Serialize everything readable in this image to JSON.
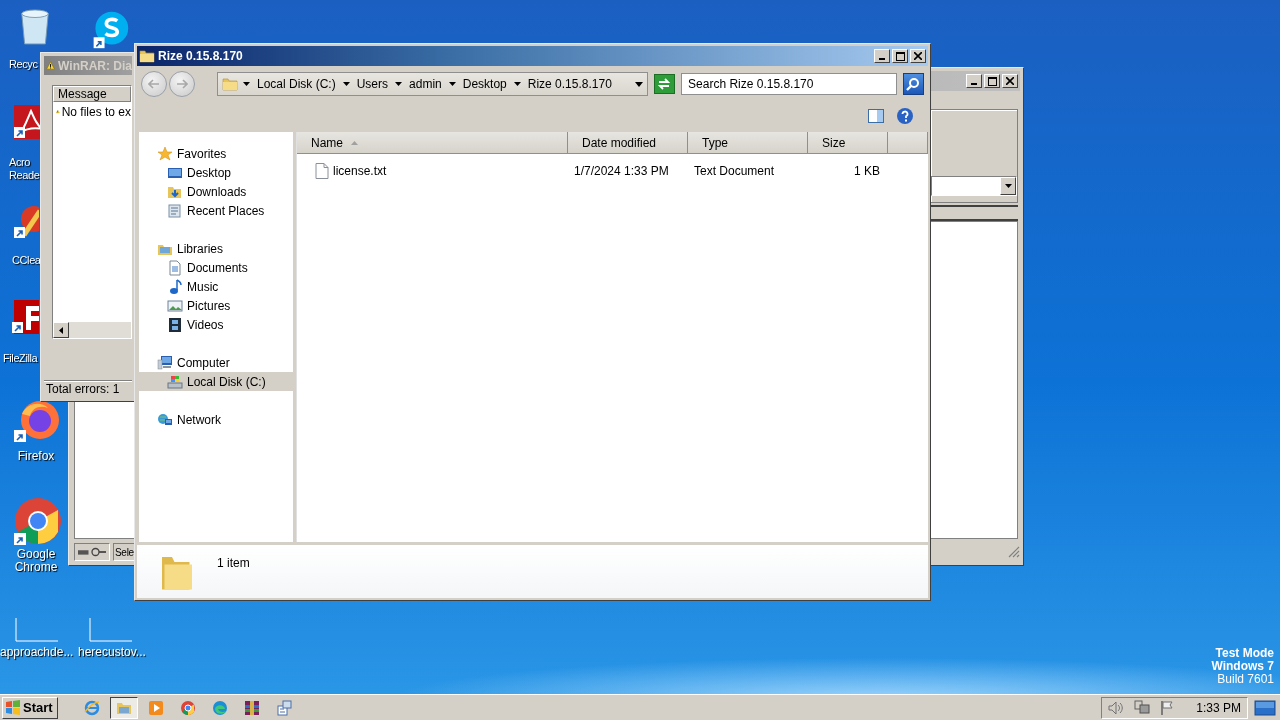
{
  "window": {
    "title": "Rize 0.15.8.170"
  },
  "address_bar": {
    "breadcrumbs": [
      "Local Disk (C:)",
      "Users",
      "admin",
      "Desktop",
      "Rize 0.15.8.170"
    ]
  },
  "search": {
    "placeholder": "Search Rize 0.15.8.170"
  },
  "sidebar": {
    "items": [
      {
        "label": "Favorites",
        "selected": false,
        "children": [
          {
            "label": "Desktop",
            "selected": false
          },
          {
            "label": "Downloads",
            "selected": false
          },
          {
            "label": "Recent Places",
            "selected": false
          }
        ]
      },
      {
        "label": "Libraries",
        "selected": false,
        "children": [
          {
            "label": "Documents",
            "selected": false
          },
          {
            "label": "Music",
            "selected": false
          },
          {
            "label": "Pictures",
            "selected": false
          },
          {
            "label": "Videos",
            "selected": false
          }
        ]
      },
      {
        "label": "Computer",
        "selected": false,
        "children": [
          {
            "label": "Local Disk (C:)",
            "selected": true
          }
        ]
      },
      {
        "label": "Network",
        "selected": false
      }
    ]
  },
  "file_list": {
    "columns": [
      {
        "label": "Name",
        "sorted": true
      },
      {
        "label": "Date modified",
        "sorted": false
      },
      {
        "label": "Type",
        "sorted": false
      },
      {
        "label": "Size",
        "sorted": false
      }
    ],
    "rows": [
      {
        "name": "license.txt",
        "date_modified": "1/7/2024 1:33 PM",
        "type": "Text Document",
        "size": "1 KB",
        "selected": false
      }
    ]
  },
  "details_pane": {
    "text": "1 item"
  },
  "winrar_dialog": {
    "title": "WinRAR: Dia",
    "columns": [
      "Message"
    ],
    "messages": [
      "No files to ex"
    ],
    "status": "Total errors: 1"
  },
  "background_window": {
    "status": "Sele"
  },
  "desktop_icons": [
    {
      "label": "Recyc"
    },
    {
      "label": "Acro Reade"
    },
    {
      "label": "CClea"
    },
    {
      "label": "FileZilla"
    },
    {
      "label": "Firefox"
    },
    {
      "label": "Google Chrome"
    },
    {
      "label": "approachde..."
    },
    {
      "label": "herecustov..."
    }
  ],
  "desktop_notice": [
    "Test Mode",
    "Windows 7",
    "Build 7601"
  ],
  "taskbar": {
    "start": "Start",
    "buttons": [
      {
        "selected": false
      },
      {
        "selected": true
      },
      {
        "selected": false
      },
      {
        "selected": false
      },
      {
        "selected": false
      },
      {
        "selected": false
      },
      {
        "selected": false
      }
    ],
    "clock": "1:33 PM"
  }
}
